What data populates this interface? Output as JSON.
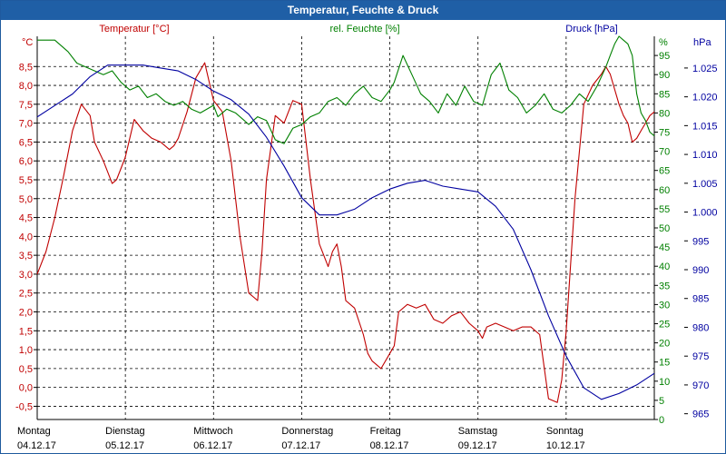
{
  "window": {
    "title": "Temperatur, Feuchte & Druck"
  },
  "chart_data": {
    "type": "line",
    "title": "Temperatur, Feuchte & Druck",
    "grid": true,
    "colors": {
      "temperature": "#c00000",
      "humidity": "#008000",
      "pressure": "#0000a0",
      "title_bar": "#1f5fa6"
    },
    "x_ticks": [
      {
        "day": "Montag",
        "date": "04.12.17"
      },
      {
        "day": "Dienstag",
        "date": "05.12.17"
      },
      {
        "day": "Mittwoch",
        "date": "06.12.17"
      },
      {
        "day": "Donnerstag",
        "date": "07.12.17"
      },
      {
        "day": "Freitag",
        "date": "08.12.17"
      },
      {
        "day": "Samstag",
        "date": "09.12.17"
      },
      {
        "day": "Sonntag",
        "date": "10.12.17"
      }
    ],
    "x_range_days": [
      0,
      7
    ],
    "axes": {
      "temperature": {
        "label": "Temperatur [°C]",
        "unit": "°C",
        "side": "left",
        "range": [
          -0.85,
          9.3
        ],
        "ticks": [
          "-0,5",
          "0,0",
          "0,5",
          "1,0",
          "1,5",
          "2,0",
          "2,5",
          "3,0",
          "3,5",
          "4,0",
          "4,5",
          "5,0",
          "5,5",
          "6,0",
          "6,5",
          "7,0",
          "7,5",
          "8,0",
          "8,5"
        ],
        "tick_values": [
          -0.5,
          0,
          0.5,
          1,
          1.5,
          2,
          2.5,
          3,
          3.5,
          4,
          4.5,
          5,
          5.5,
          6,
          6.5,
          7,
          7.5,
          8,
          8.5
        ]
      },
      "humidity": {
        "label": "rel. Feuchte [%]",
        "unit": "%",
        "side": "right-inner",
        "range": [
          0,
          100
        ],
        "ticks": [
          "0",
          "5",
          "10",
          "15",
          "20",
          "25",
          "30",
          "35",
          "40",
          "45",
          "50",
          "55",
          "60",
          "65",
          "70",
          "75",
          "80",
          "85",
          "90",
          "95"
        ],
        "tick_values": [
          0,
          5,
          10,
          15,
          20,
          25,
          30,
          35,
          40,
          45,
          50,
          55,
          60,
          65,
          70,
          75,
          80,
          85,
          90,
          95
        ]
      },
      "pressure": {
        "label": "Druck [hPa]",
        "unit": "hPa",
        "side": "right-outer",
        "range": [
          964,
          1030.5
        ],
        "ticks": [
          "965",
          "970",
          "975",
          "980",
          "985",
          "990",
          "995",
          "1.000",
          "1.005",
          "1.010",
          "1.015",
          "1.020",
          "1.025"
        ],
        "tick_values": [
          965,
          970,
          975,
          980,
          985,
          990,
          995,
          1000,
          1005,
          1010,
          1015,
          1020,
          1025
        ]
      }
    },
    "series": [
      {
        "name": "Temperatur [°C]",
        "axis": "temperature",
        "x": [
          0,
          0.1,
          0.2,
          0.3,
          0.4,
          0.5,
          0.6,
          0.65,
          0.75,
          0.85,
          0.9,
          0.95,
          1.0,
          1.05,
          1.1,
          1.2,
          1.3,
          1.4,
          1.5,
          1.55,
          1.6,
          1.7,
          1.8,
          1.9,
          2.0,
          2.1,
          2.2,
          2.3,
          2.4,
          2.5,
          2.55,
          2.6,
          2.7,
          2.8,
          2.9,
          3.0,
          3.1,
          3.2,
          3.3,
          3.35,
          3.4,
          3.45,
          3.5,
          3.6,
          3.7,
          3.75,
          3.8,
          3.9,
          4.0,
          4.05,
          4.1,
          4.2,
          4.3,
          4.4,
          4.5,
          4.6,
          4.7,
          4.8,
          4.9,
          5.0,
          5.05,
          5.1,
          5.2,
          5.3,
          5.4,
          5.5,
          5.6,
          5.7,
          5.8,
          5.9,
          5.95,
          6.0,
          6.1,
          6.2,
          6.3,
          6.4,
          6.45,
          6.5,
          6.6,
          6.65,
          6.7,
          6.75,
          6.8,
          6.85,
          6.9,
          6.95,
          7.0
        ],
        "values": [
          3.0,
          3.6,
          4.5,
          5.6,
          6.8,
          7.5,
          7.2,
          6.5,
          6.0,
          5.4,
          5.5,
          5.8,
          6.1,
          6.6,
          7.1,
          6.8,
          6.6,
          6.5,
          6.3,
          6.4,
          6.6,
          7.3,
          8.2,
          8.6,
          7.6,
          7.3,
          6.0,
          4.0,
          2.5,
          2.3,
          3.6,
          5.5,
          7.2,
          7.0,
          7.6,
          7.5,
          5.5,
          3.8,
          3.2,
          3.6,
          3.8,
          3.2,
          2.3,
          2.1,
          1.4,
          0.9,
          0.7,
          0.5,
          0.9,
          1.1,
          2.0,
          2.2,
          2.1,
          2.2,
          1.8,
          1.7,
          1.9,
          2.0,
          1.7,
          1.5,
          1.3,
          1.6,
          1.7,
          1.6,
          1.5,
          1.6,
          1.6,
          1.4,
          -0.3,
          -0.4,
          0.2,
          1.5,
          5.0,
          7.5,
          8.0,
          8.3,
          8.5,
          8.3,
          7.5,
          7.2,
          7.0,
          6.5,
          6.6,
          6.8,
          7.0,
          7.2,
          7.3
        ],
        "color": "#c00000"
      },
      {
        "name": "rel. Feuchte [%]",
        "axis": "humidity",
        "x": [
          0,
          0.2,
          0.35,
          0.45,
          0.55,
          0.65,
          0.75,
          0.85,
          0.95,
          1.05,
          1.15,
          1.25,
          1.35,
          1.45,
          1.55,
          1.65,
          1.75,
          1.85,
          2.0,
          2.05,
          2.15,
          2.25,
          2.35,
          2.4,
          2.5,
          2.6,
          2.7,
          2.8,
          2.9,
          3.0,
          3.1,
          3.2,
          3.3,
          3.4,
          3.5,
          3.6,
          3.7,
          3.8,
          3.9,
          4.0,
          4.05,
          4.15,
          4.25,
          4.35,
          4.45,
          4.55,
          4.65,
          4.75,
          4.85,
          4.95,
          5.05,
          5.15,
          5.25,
          5.35,
          5.45,
          5.55,
          5.65,
          5.75,
          5.85,
          5.95,
          6.05,
          6.15,
          6.25,
          6.35,
          6.45,
          6.5,
          6.55,
          6.6,
          6.65,
          6.7,
          6.75,
          6.8,
          6.85,
          6.9,
          6.95,
          7.0
        ],
        "values": [
          99,
          99,
          96,
          93,
          92,
          91,
          90,
          91,
          88,
          86,
          87,
          84,
          85,
          83,
          82,
          83,
          81,
          80,
          82,
          79,
          81,
          80,
          78,
          77,
          79,
          78,
          73,
          72,
          76,
          77,
          79,
          80,
          83,
          84,
          82,
          85,
          87,
          84,
          83,
          86,
          88,
          95,
          90,
          85,
          83,
          80,
          85,
          82,
          87,
          83,
          82,
          90,
          93,
          86,
          84,
          80,
          82,
          85,
          81,
          80,
          82,
          85,
          83,
          87,
          92,
          95,
          98,
          100,
          99,
          98,
          95,
          85,
          80,
          78,
          75,
          74
        ],
        "color": "#008000"
      },
      {
        "name": "Druck [hPa]",
        "axis": "pressure",
        "x": [
          0,
          0.2,
          0.4,
          0.6,
          0.8,
          1.0,
          1.2,
          1.4,
          1.6,
          1.8,
          2.0,
          2.2,
          2.4,
          2.6,
          2.8,
          3.0,
          3.2,
          3.4,
          3.6,
          3.8,
          4.0,
          4.2,
          4.4,
          4.6,
          4.8,
          5.0,
          5.2,
          5.4,
          5.6,
          5.8,
          6.0,
          6.2,
          6.4,
          6.6,
          6.8,
          6.9,
          7.0
        ],
        "values": [
          1016.5,
          1018.5,
          1020.5,
          1023.5,
          1025.5,
          1025.5,
          1025.5,
          1025.0,
          1024.5,
          1023.0,
          1021.0,
          1019.5,
          1017.0,
          1013.0,
          1008.0,
          1002.5,
          999.5,
          999.5,
          1000.5,
          1002.5,
          1004.0,
          1005.0,
          1005.5,
          1004.5,
          1004.0,
          1003.5,
          1001.0,
          997.0,
          990.0,
          982.0,
          975.0,
          969.5,
          967.5,
          968.5,
          970.0,
          971.0,
          972.0
        ],
        "color": "#0000a0"
      }
    ]
  }
}
